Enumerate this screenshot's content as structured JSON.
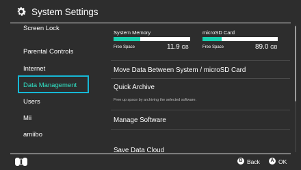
{
  "header": {
    "title": "System Settings",
    "icon": "gear-icon"
  },
  "sidebar": {
    "items": [
      {
        "label": "Screen Lock"
      },
      {
        "label": "Parental Controls"
      },
      {
        "label": "Internet"
      },
      {
        "label": "Data Management",
        "selected": true
      },
      {
        "label": "Users"
      },
      {
        "label": "Mii"
      },
      {
        "label": "amiibo"
      }
    ]
  },
  "memory": {
    "system": {
      "label": "System Memory",
      "free_label": "Free Space",
      "free_value": "11.9",
      "unit": "GB",
      "used_fraction": 0.35
    },
    "sd": {
      "label": "microSD Card",
      "free_label": "Free Space",
      "free_value": "89.0",
      "unit": "GB",
      "used_fraction": 0.25
    }
  },
  "main": {
    "items": [
      {
        "label": "Move Data Between System / microSD Card"
      },
      {
        "label": "Quick Archive",
        "description": "Free up space by archiving the selected software."
      },
      {
        "label": "Manage Software"
      },
      {
        "label": "Save Data Cloud"
      }
    ]
  },
  "footer": {
    "back": {
      "button": "B",
      "label": "Back"
    },
    "ok": {
      "button": "A",
      "label": "OK"
    },
    "controller_icon": "joycon-icon"
  },
  "colors": {
    "background": "#2d2d2d",
    "selection_border": "#16b8d6",
    "selection_text": "#2fe2c5",
    "bar_fill": "#1ad0b0"
  }
}
